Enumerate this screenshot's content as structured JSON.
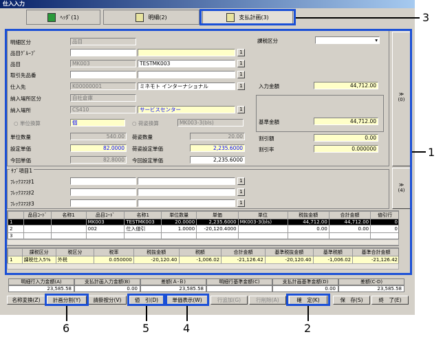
{
  "window": {
    "title": "仕入入力"
  },
  "tabs": [
    {
      "label": "ﾍｯﾀﾞ(1)"
    },
    {
      "label": "明細(2)"
    },
    {
      "label": "支払計画(3)"
    }
  ],
  "form": {
    "meisai_kubun": {
      "label": "明細区分",
      "value": "品目"
    },
    "hinmoku_group": {
      "label": "品目ｸﾞﾙｰﾌﾟ",
      "value": "",
      "name": ""
    },
    "hinmoku": {
      "label": "品目",
      "value": "MK003",
      "name": "TESTMK003"
    },
    "torihiki_hinban": {
      "label": "取引先品番",
      "value": "",
      "name": ""
    },
    "shiiresaki": {
      "label": "仕入先",
      "value": "K00000001",
      "name": "ミネモト インターナショナル"
    },
    "nounyu_kubun": {
      "label": "納入場所区分",
      "value": "自社倉庫"
    },
    "nounyu_basho": {
      "label": "納入場所",
      "value": "CS410",
      "name": "サービスセンター"
    },
    "tani_kanzan": {
      "label": "単位換算",
      "value": "個"
    },
    "nisugata_kanzan": {
      "label": "荷姿換算",
      "value": "MK003-3(bls)"
    },
    "tani_suryo": {
      "label": "単位数量",
      "value": "540.00"
    },
    "settei_tanka": {
      "label": "設定単価",
      "value": "82.0000"
    },
    "konkai_tanka": {
      "label": "今回単価",
      "value": "82.8000"
    },
    "nisugata_suryo": {
      "label": "荷姿数量",
      "value": "20.00"
    },
    "nisugata_settei": {
      "label": "荷姿設定単価",
      "value": "2,235.6000"
    },
    "konkai_settei": {
      "label": "今回設定単価",
      "value": "2,235.6000"
    },
    "kazei_kubun": {
      "label": "課税区分",
      "value": ""
    },
    "nyuryoku_kingaku": {
      "label": "入力金額",
      "value": "44,712.00"
    },
    "kijun_kingaku": {
      "label": "基準金額",
      "value": "44,712.00"
    },
    "waribiki_gaku": {
      "label": "割引額",
      "value": "0.00"
    },
    "waribiki_ritsu": {
      "label": "割引率",
      "value": "0.000000"
    },
    "side_btn_1": "(0)",
    "side_btn_2": "(4)",
    "side_btn_arrows": "≫",
    "sub_section": "ｻﾌﾞ項目1",
    "flex": [
      {
        "label": "ﾌﾚｯｸｽﾏｽﾀ1"
      },
      {
        "label": "ﾌﾚｯｸｽﾏｽﾀ2"
      },
      {
        "label": "ﾌﾚｯｸｽﾏｽﾀ3"
      }
    ],
    "btn_char": "1"
  },
  "grid1": {
    "headers": [
      "",
      "品目ｺｰﾄﾞ",
      "名称1",
      "品目ｺｰﾄﾞ",
      "名称1",
      "単位数量",
      "単価",
      "単位",
      "税抜金額",
      "合計金額",
      "値引行"
    ],
    "rows": [
      [
        "1",
        "",
        "",
        "MK003",
        "TESTMK003",
        "20.0000",
        "2,235.6000",
        "MK003-3(bls)",
        "44,712.00",
        "44,712.00",
        "0"
      ],
      [
        "2",
        "",
        "",
        "002",
        "仕入値引",
        "1.0000",
        "-20,120.4000",
        "",
        "0.00",
        "0.00",
        "0"
      ],
      [
        "3",
        "",
        "",
        "",
        "",
        "",
        "",
        "",
        "",
        "",
        ""
      ]
    ]
  },
  "grid2": {
    "headers": [
      "",
      "課税区分",
      "税区分",
      "税率",
      "税抜金額",
      "税額",
      "合計金額",
      "基準税抜金額",
      "基準税額",
      "基準合計金額"
    ],
    "rows": [
      [
        "1",
        "課税仕入5%",
        "外税",
        "0.050000",
        "-20,120.40",
        "-1,006.02",
        "-21,126.42",
        "-20,120.40",
        "-1,006.02",
        "-21,126.42"
      ]
    ]
  },
  "summary": {
    "headers": [
      "明細行入力金額(A)",
      "支払計画入力金額(B)",
      "差額(Ａ-Ｂ)",
      "明細行基準金額(C)",
      "支払計画基準金額(D)",
      "差額(C-D)"
    ],
    "values": [
      "23,585.58",
      "0.00",
      "23,585.58",
      "",
      "0.00",
      "23,585.58"
    ]
  },
  "buttons": {
    "meisho_henkan": "名称変換(Z)",
    "keikaku_bunkatsu": "計画分割(Y)",
    "shiharai_bunkatsu": "請掛按分(V)",
    "nebiki": "値　引(D)",
    "tanka_hyouji": "単価表示(W)",
    "gyo_tsuika": "行追加(G)",
    "gyo_sakujo": "行削除(A)",
    "kakutei": "確　定(K)",
    "hozon": "保　存(S)",
    "shuryo": "終　了(E)"
  },
  "callouts": {
    "c1": "1",
    "c2": "2",
    "c3": "3",
    "c4": "4",
    "c5": "5",
    "c6": "6"
  }
}
